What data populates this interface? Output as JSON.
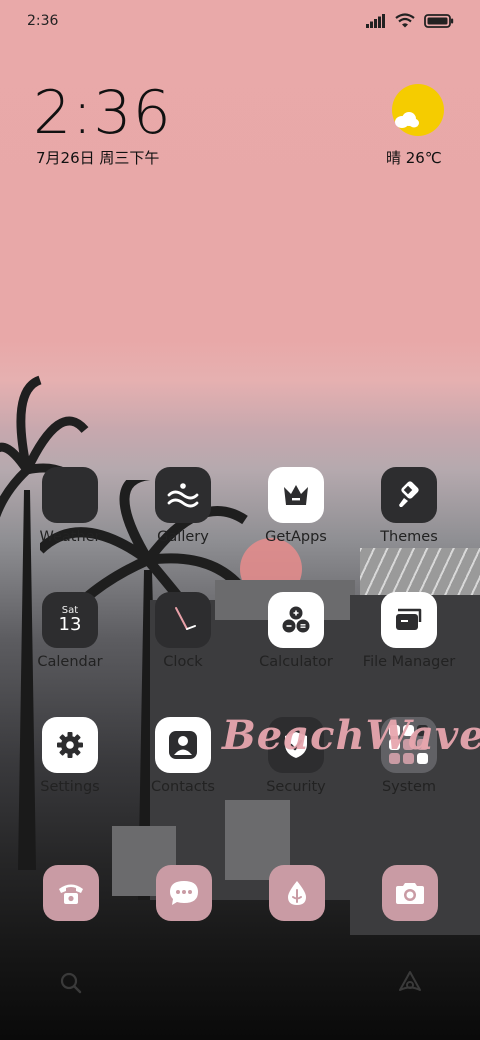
{
  "status_bar": {
    "time": "2:36"
  },
  "clock_widget": {
    "time": "2:36",
    "date": "7月26日 周三下午"
  },
  "weather_widget": {
    "condition_temp": "晴 26℃"
  },
  "apps_row1": [
    {
      "label": "Weather",
      "icon": "weather-app-icon",
      "style": "dark"
    },
    {
      "label": "Gallery",
      "icon": "gallery-icon",
      "style": "dark"
    },
    {
      "label": "GetApps",
      "icon": "getapps-crown-icon",
      "style": "light"
    },
    {
      "label": "Themes",
      "icon": "paintbrush-icon",
      "style": "dark"
    }
  ],
  "apps_row2": [
    {
      "label": "Calendar",
      "icon": "calendar-icon",
      "style": "dark",
      "day": "Sat",
      "date": "13"
    },
    {
      "label": "Clock",
      "icon": "clock-icon",
      "style": "dark"
    },
    {
      "label": "Calculator",
      "icon": "calculator-icon",
      "style": "light"
    },
    {
      "label": "File Manager",
      "icon": "folder-icon",
      "style": "light"
    }
  ],
  "apps_row3": [
    {
      "label": "Settings",
      "icon": "gear-icon",
      "style": "light"
    },
    {
      "label": "Contacts",
      "icon": "person-icon",
      "style": "light"
    },
    {
      "label": "Security",
      "icon": "shield-check-icon",
      "style": "dark"
    },
    {
      "label": "System",
      "icon": "folder-grid-icon",
      "style": "folder"
    }
  ],
  "dock": [
    {
      "icon": "phone-icon"
    },
    {
      "icon": "messages-icon"
    },
    {
      "icon": "browser-drop-icon"
    },
    {
      "icon": "camera-icon"
    }
  ],
  "watermark": "BeachWave",
  "colors": {
    "wallpaper_top": "#e9a9a9",
    "dock_tile": "#c99ba4",
    "weather_sun": "#f5cc00"
  }
}
